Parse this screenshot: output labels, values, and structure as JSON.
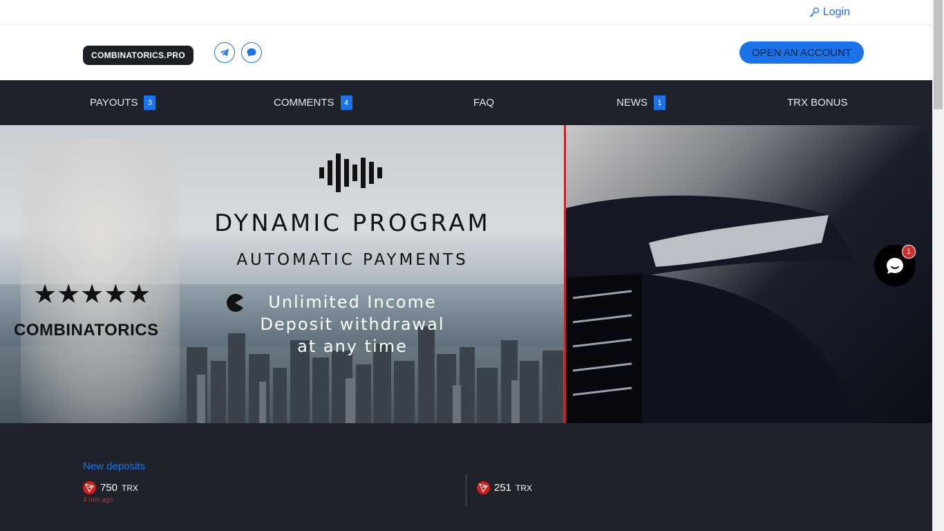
{
  "topbar": {
    "login_label": "Login",
    "login_icon": "key-icon"
  },
  "header": {
    "logo_text": "COMBINATORICS.PRO",
    "social": [
      "telegram-icon",
      "chat-bubble-icon"
    ],
    "open_account_label": "OPEN AN ACCOUNT"
  },
  "nav": {
    "items": [
      {
        "label": "PAYOUTS",
        "badge": "3"
      },
      {
        "label": "COMMENTS",
        "badge": "4"
      },
      {
        "label": "FAQ",
        "badge": ""
      },
      {
        "label": "NEWS",
        "badge": "1"
      },
      {
        "label": "TRX BONUS",
        "badge": ""
      }
    ]
  },
  "banner": {
    "title": "DYNAMIC PROGRAM",
    "subtitle": "AUTOMATIC PAYMENTS",
    "line1": "Unlimited Income",
    "line2": "Deposit withdrawal",
    "line3": "at any time",
    "stars": "★★★★★",
    "brand": "COMBINATORICS"
  },
  "chat_widget": {
    "badge": "1"
  },
  "deposits": {
    "title": "New deposits",
    "entries": [
      {
        "amount": "750",
        "unit": "TRX",
        "time": "4 min ago"
      },
      {
        "amount": "251",
        "unit": "TRX",
        "time": ""
      }
    ]
  },
  "colors": {
    "accent": "#1a73e8",
    "dark": "#1f222b",
    "alert": "#d42a2a"
  }
}
